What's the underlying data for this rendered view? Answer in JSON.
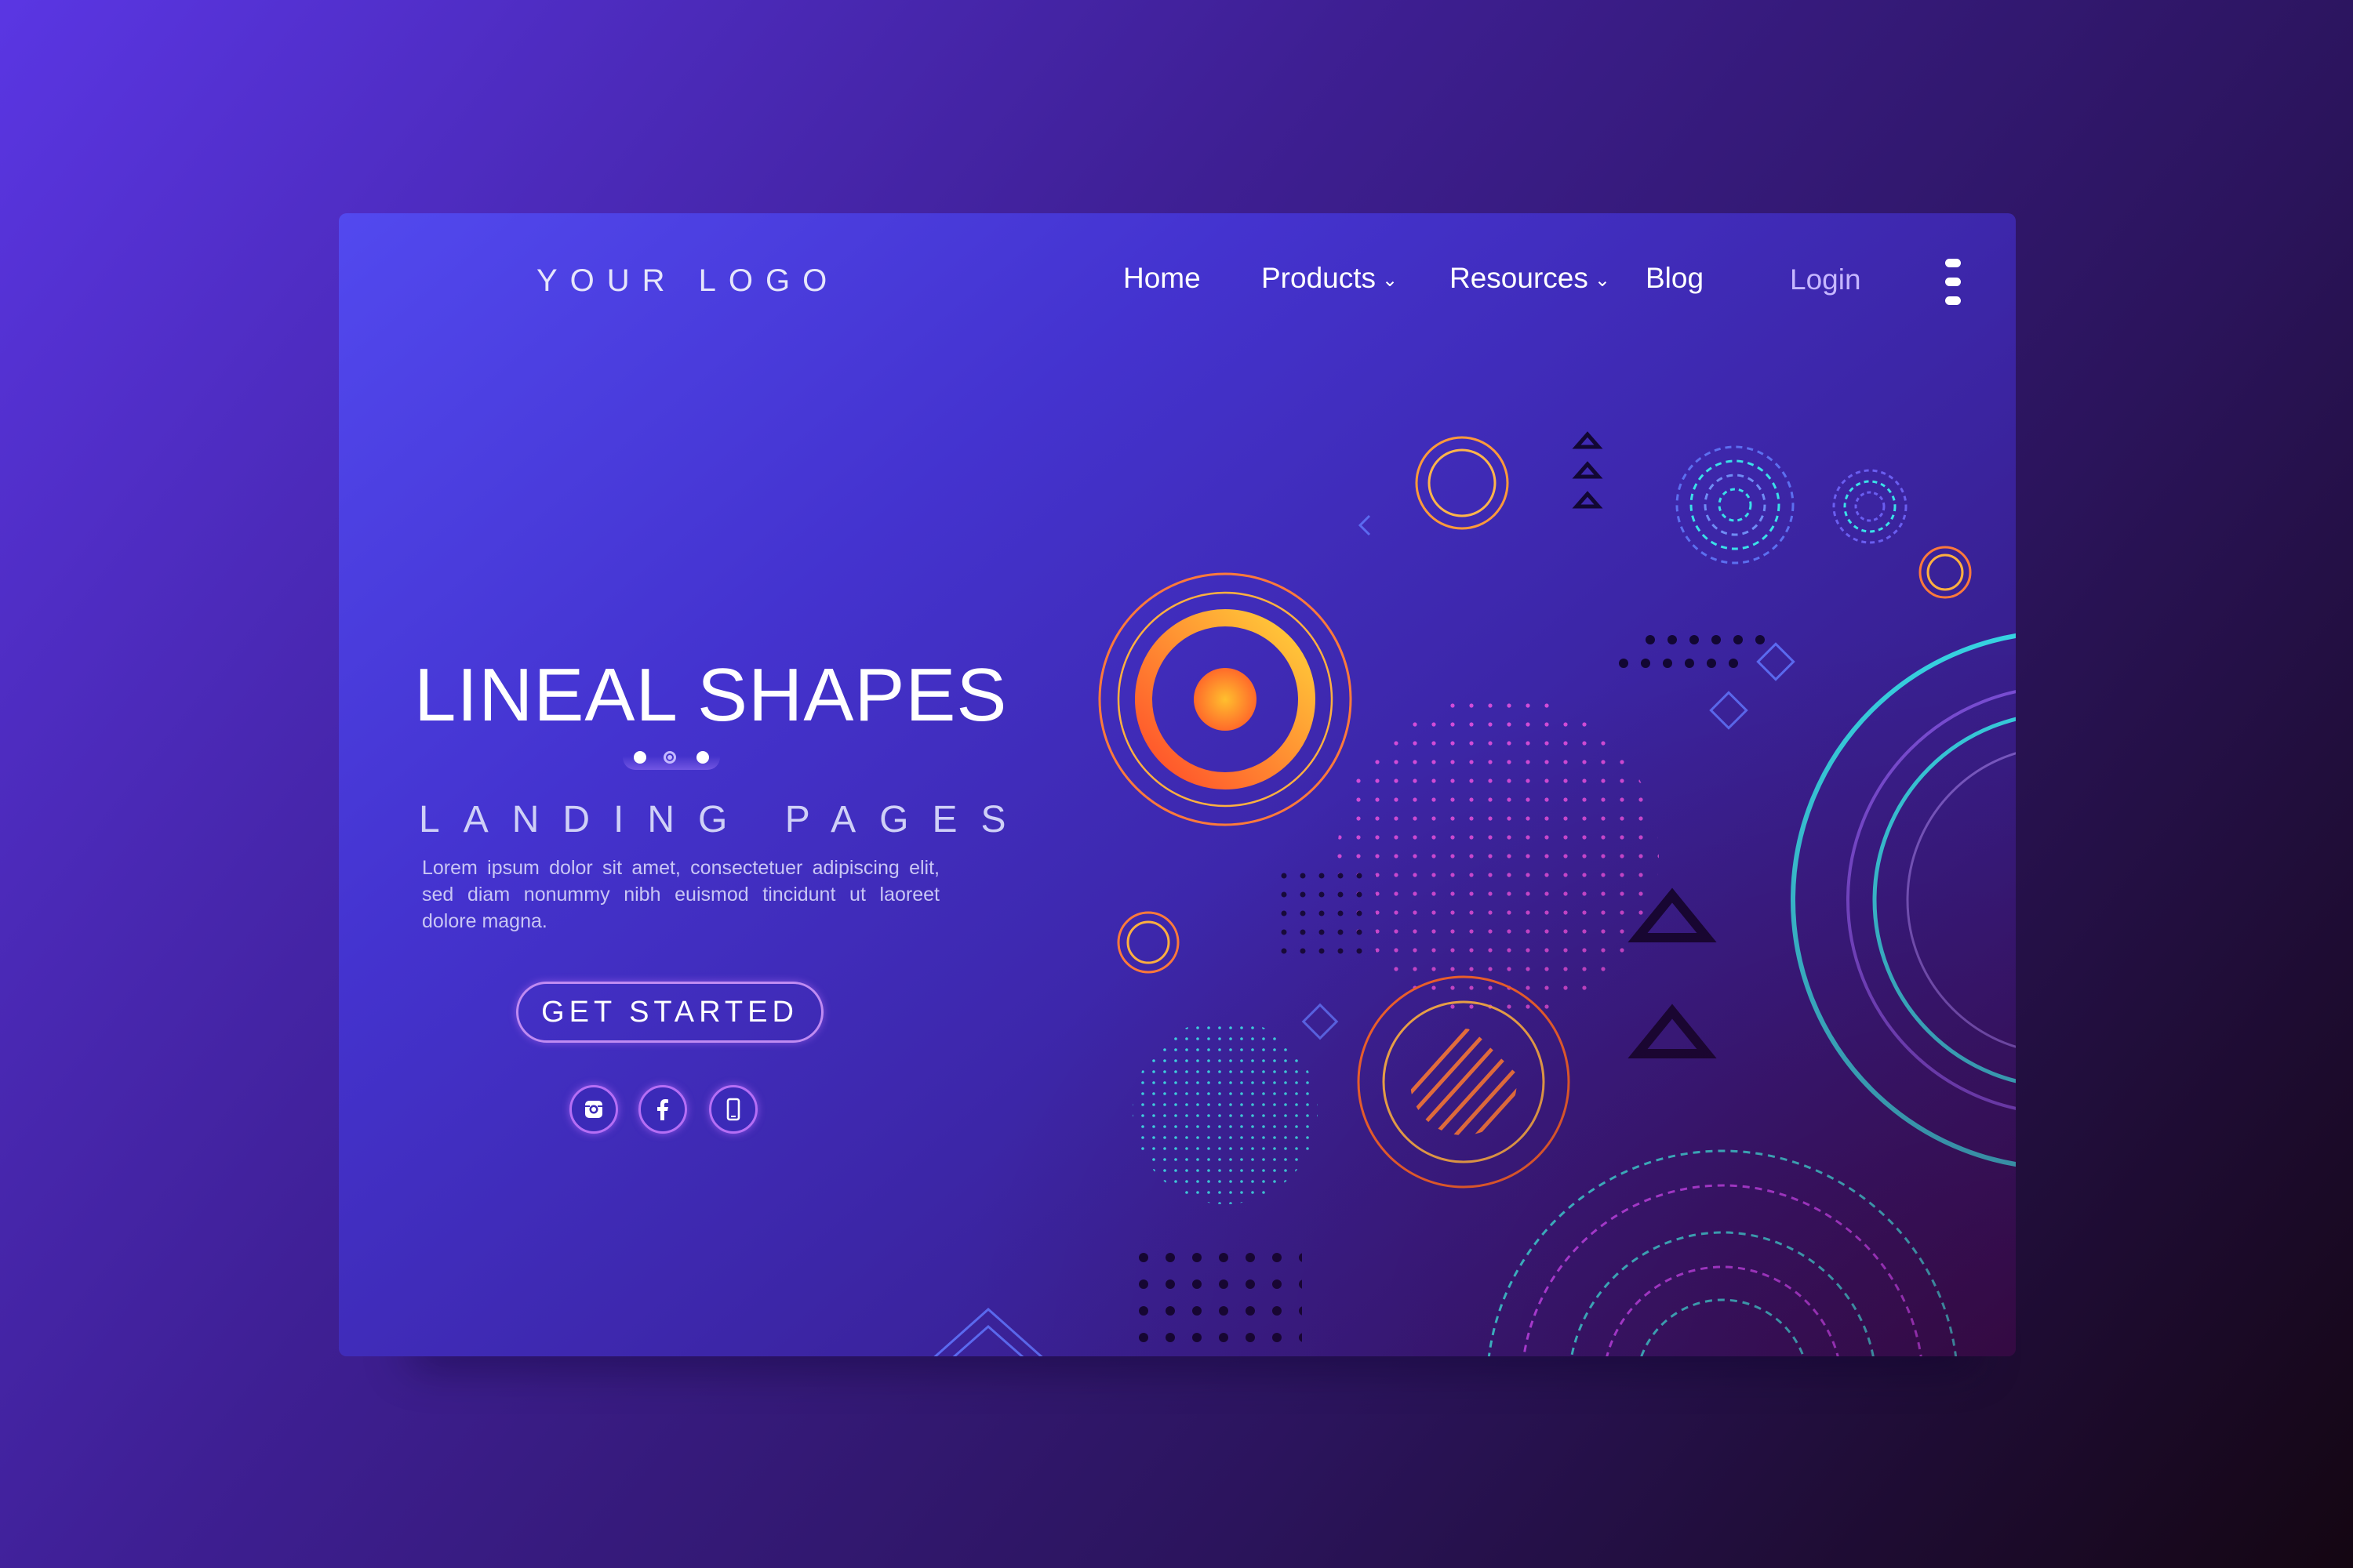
{
  "brand": {
    "logo_text": "YOUR LOGO"
  },
  "nav": {
    "items": [
      {
        "label": "Home",
        "has_dropdown": false
      },
      {
        "label": "Products",
        "has_dropdown": true
      },
      {
        "label": "Resources",
        "has_dropdown": true
      },
      {
        "label": "Blog",
        "has_dropdown": false
      }
    ],
    "dropdown_glyph": "⌄",
    "login_label": "Login",
    "menu_icon": "vertical-ellipsis-icon"
  },
  "hero": {
    "title": "LINEAL SHAPES",
    "subtitle": "LANDING PAGES",
    "body": "Lorem ipsum dolor sit amet, consectetuer adipiscing elit, sed diam nonummy nibh euismod tincidunt ut laoreet dolore magna.",
    "cta_label": "GET STARTED",
    "slider": {
      "count": 3,
      "active_index": 1
    }
  },
  "social": [
    {
      "icon": "instagram-icon"
    },
    {
      "icon": "facebook-icon"
    },
    {
      "icon": "phone-icon"
    }
  ],
  "colors": {
    "accent_orange": "#ff8a2a",
    "accent_yellow": "#ffc33a",
    "accent_cyan": "#3be0e8",
    "accent_magenta": "#c64bff",
    "cta_border": "#c08bf2"
  }
}
